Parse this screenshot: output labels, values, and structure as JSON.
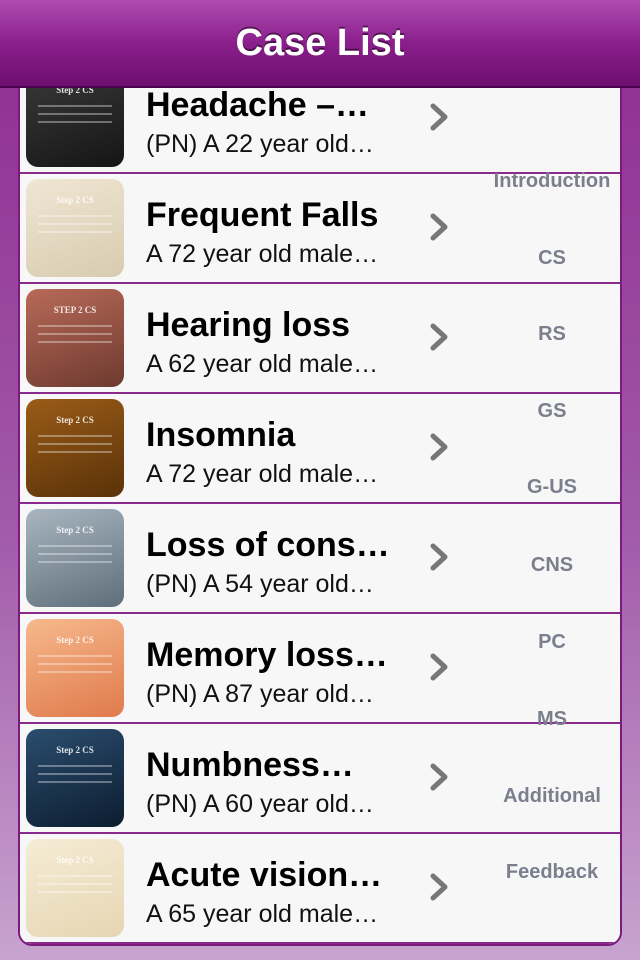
{
  "navbar": {
    "title": "Case List"
  },
  "cases": [
    {
      "title": "Headache –…",
      "subtitle": "(PN) A 22 year old…",
      "thumb_caption": "Step 2 CS",
      "thumb_colors": [
        "#3a3a3a",
        "#151515"
      ]
    },
    {
      "title": "Frequent Falls",
      "subtitle": "A 72 year old male…",
      "thumb_caption": "Step 2 CS",
      "thumb_colors": [
        "#efe6d3",
        "#d8cbb0"
      ]
    },
    {
      "title": "Hearing loss",
      "subtitle": "A 62 year old male…",
      "thumb_caption": "STEP 2 CS",
      "thumb_colors": [
        "#b86a58",
        "#6e3a2f"
      ]
    },
    {
      "title": "Insomnia",
      "subtitle": "A 72 year old male…",
      "thumb_caption": "Step 2 CS",
      "thumb_colors": [
        "#9a5c18",
        "#5a3208"
      ]
    },
    {
      "title": "Loss of cons…",
      "subtitle": "(PN) A 54 year old…",
      "thumb_caption": "Step 2 CS",
      "thumb_colors": [
        "#a9b6c0",
        "#5e6e7a"
      ]
    },
    {
      "title": "Memory loss…",
      "subtitle": "(PN) A 87 year old…",
      "thumb_caption": "Step 2 CS",
      "thumb_colors": [
        "#f6b98c",
        "#e07a4c"
      ]
    },
    {
      "title": "Numbness…",
      "subtitle": "(PN) A 60 year old…",
      "thumb_caption": "Step 2 CS",
      "thumb_colors": [
        "#2b4d6e",
        "#0c1d30"
      ]
    },
    {
      "title": "Acute vision…",
      "subtitle": "A 65 year old male…",
      "thumb_caption": "Step 2 CS",
      "thumb_colors": [
        "#f5ecd6",
        "#e6d6b2"
      ]
    }
  ],
  "section_index": [
    "Introduction",
    "CS",
    "RS",
    "GS",
    "G-US",
    "CNS",
    "PC",
    "MS",
    "Additional",
    "Feedback"
  ],
  "colors": {
    "accent": "#8a1f8c",
    "index_text": "#7b7f8d"
  }
}
